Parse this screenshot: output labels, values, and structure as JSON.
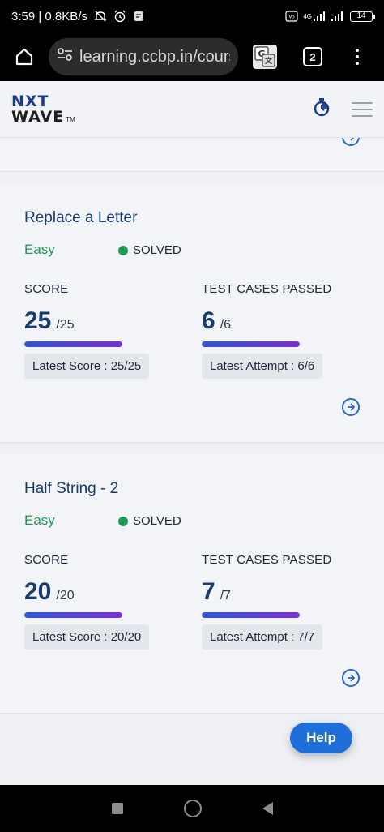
{
  "status_bar": {
    "time_speed": "3:59 | 0.8KB/s",
    "battery": "14",
    "network_label": "4G"
  },
  "browser": {
    "url": "learning.ccbp.in/cours",
    "tabs_count": "2"
  },
  "app": {
    "logo_top": "NXT",
    "logo_bottom": "WAVE",
    "logo_tm": "TM"
  },
  "questions": [
    {
      "title": "Replace a Letter",
      "difficulty": "Easy",
      "status": "SOLVED",
      "score_label": "SCORE",
      "score": "25",
      "score_total": "/25",
      "score_fraction": 1.0,
      "latest_score": "Latest Score : 25/25",
      "tests_label": "TEST CASES PASSED",
      "tests": "6",
      "tests_total": "/6",
      "tests_fraction": 1.0,
      "latest_attempt": "Latest Attempt : 6/6"
    },
    {
      "title": "Half String - 2",
      "difficulty": "Easy",
      "status": "SOLVED",
      "score_label": "SCORE",
      "score": "20",
      "score_total": "/20",
      "score_fraction": 1.0,
      "latest_score": "Latest Score : 20/20",
      "tests_label": "TEST CASES PASSED",
      "tests": "7",
      "tests_total": "/7",
      "tests_fraction": 1.0,
      "latest_attempt": "Latest Attempt : 7/7"
    }
  ],
  "help_button": {
    "label": "Help"
  },
  "colors": {
    "accent": "#1e6fd9",
    "title": "#183b6e",
    "easy": "#1d9a55",
    "progress_start": "#2f56d8",
    "progress_end": "#7b2fd6"
  },
  "icons": {
    "home": "home-icon",
    "tune": "tune-icon",
    "translate": "translate-icon",
    "menu": "more-vert-icon",
    "timer": "stopwatch-icon",
    "hamburger": "hamburger-icon",
    "arrow": "arrow-circle-right-icon"
  }
}
